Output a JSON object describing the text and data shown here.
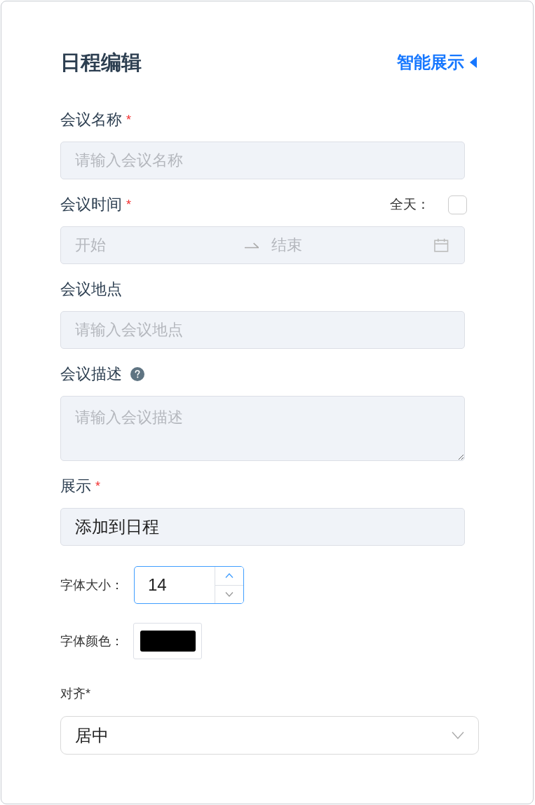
{
  "header": {
    "title": "日程编辑",
    "smart_display": {
      "label": "智能展示",
      "expanded": false
    }
  },
  "fields": [
    {
      "kind": "text",
      "label": "会议名称",
      "required_mark": "*",
      "help": false,
      "placeholder": "请输入会议名称"
    },
    {
      "kind": "daterange",
      "label": "会议时间",
      "required_mark": "*",
      "help": false,
      "all_day": {
        "label": "全天：",
        "checked": false
      },
      "start_placeholder": "开始",
      "end_placeholder": "结束"
    },
    {
      "kind": "text",
      "label": "会议地点",
      "help": false,
      "placeholder": "请输入会议地点"
    },
    {
      "kind": "textarea",
      "label": "会议描述",
      "help": true,
      "placeholder": "请输入会议描述"
    },
    {
      "kind": "text",
      "label": "展示",
      "required_mark": "*",
      "help": false,
      "value": "添加到日程"
    }
  ],
  "font_size": {
    "label": "字体大小：",
    "value": "14"
  },
  "font_color": {
    "label": "字体颜色：",
    "color": "#000000"
  },
  "align": {
    "label": "对齐*",
    "value": "居中"
  }
}
